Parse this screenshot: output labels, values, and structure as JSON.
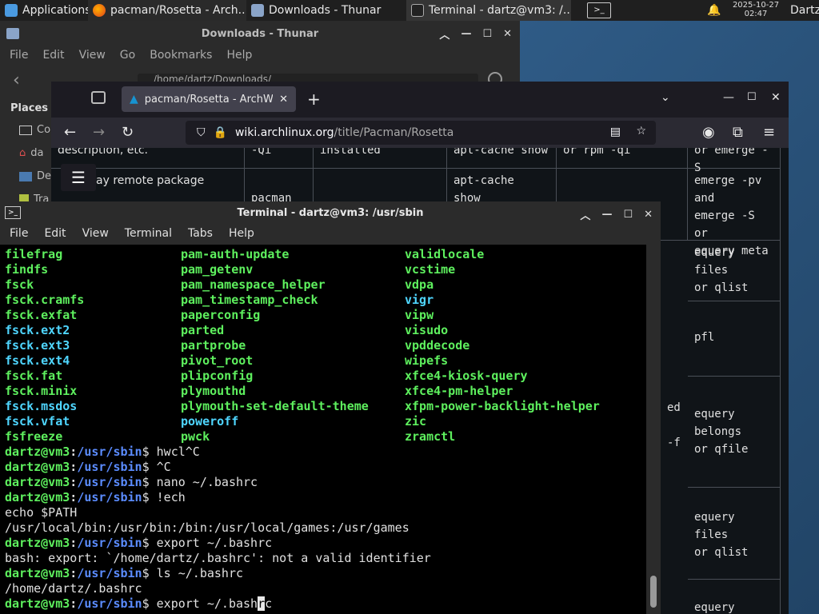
{
  "taskbar": {
    "applications": "Applications",
    "tasks": [
      {
        "label": "pacman/Rosetta - Arch..."
      },
      {
        "label": "Downloads - Thunar"
      },
      {
        "label": "Terminal - dartz@vm3: /..."
      }
    ],
    "clock_date": "2025-10-27",
    "clock_time": "02:47",
    "user": "Dartz"
  },
  "thunar": {
    "title": "Downloads - Thunar",
    "menu": [
      "File",
      "Edit",
      "View",
      "Go",
      "Bookmarks",
      "Help"
    ],
    "path": "/home/dartz/Downloads/",
    "places_heading": "Places",
    "places": [
      "Co",
      "da",
      "De",
      "Tra"
    ]
  },
  "firefox": {
    "tab_title": "pacman/Rosetta - ArchW",
    "url_host": "wiki.archlinux.org",
    "url_path": "/title/Pacman/Rosetta",
    "table": {
      "r1c0": "description, etc.",
      "r1c1": "-Qi",
      "r1c2": "installed",
      "r1c3": "apt-cache show",
      "r1c4": "or rpm -qi",
      "r1c5": "or emerge -S",
      "r2c0": "ay remote package",
      "r2c1": "pacman",
      "r2c3": "apt-cache\nshow",
      "r2c5": "emerge -pv\nand\nemerge -S or\nequery meta",
      "r3c5": "equery\nfiles\nor qlist",
      "r4c5": "pfl",
      "r5c4a": "ed",
      "r5c4b": "-f",
      "r5c5": "equery\nbelongs\nor qfile",
      "r6c5": "equery\nfiles\nor qlist",
      "r7c5": "equery"
    }
  },
  "terminal": {
    "title": "Terminal - dartz@vm3: /usr/sbin",
    "menu": [
      "File",
      "Edit",
      "View",
      "Terminal",
      "Tabs",
      "Help"
    ],
    "columns": [
      [
        {
          "t": "filefrag",
          "k": "exe"
        },
        {
          "t": "findfs",
          "k": "exe"
        },
        {
          "t": "fsck",
          "k": "exe"
        },
        {
          "t": "fsck.cramfs",
          "k": "exe"
        },
        {
          "t": "fsck.exfat",
          "k": "exe"
        },
        {
          "t": "fsck.ext2",
          "k": "lnk"
        },
        {
          "t": "fsck.ext3",
          "k": "lnk"
        },
        {
          "t": "fsck.ext4",
          "k": "lnk"
        },
        {
          "t": "fsck.fat",
          "k": "exe"
        },
        {
          "t": "fsck.minix",
          "k": "exe"
        },
        {
          "t": "fsck.msdos",
          "k": "lnk"
        },
        {
          "t": "fsck.vfat",
          "k": "lnk"
        },
        {
          "t": "fsfreeze",
          "k": "exe"
        }
      ],
      [
        {
          "t": "pam-auth-update",
          "k": "exe"
        },
        {
          "t": "pam_getenv",
          "k": "exe"
        },
        {
          "t": "pam_namespace_helper",
          "k": "exe"
        },
        {
          "t": "pam_timestamp_check",
          "k": "exe"
        },
        {
          "t": "paperconfig",
          "k": "exe"
        },
        {
          "t": "parted",
          "k": "exe"
        },
        {
          "t": "partprobe",
          "k": "exe"
        },
        {
          "t": "pivot_root",
          "k": "exe"
        },
        {
          "t": "plipconfig",
          "k": "exe"
        },
        {
          "t": "plymouthd",
          "k": "exe"
        },
        {
          "t": "plymouth-set-default-theme",
          "k": "exe"
        },
        {
          "t": "poweroff",
          "k": "lnk"
        },
        {
          "t": "pwck",
          "k": "exe"
        }
      ],
      [
        {
          "t": "validlocale",
          "k": "exe"
        },
        {
          "t": "vcstime",
          "k": "exe"
        },
        {
          "t": "vdpa",
          "k": "exe"
        },
        {
          "t": "vigr",
          "k": "lnk"
        },
        {
          "t": "vipw",
          "k": "exe"
        },
        {
          "t": "visudo",
          "k": "exe"
        },
        {
          "t": "vpddecode",
          "k": "exe"
        },
        {
          "t": "wipefs",
          "k": "exe"
        },
        {
          "t": "xfce4-kiosk-query",
          "k": "exe"
        },
        {
          "t": "xfce4-pm-helper",
          "k": "exe"
        },
        {
          "t": "xfpm-power-backlight-helper",
          "k": "exe"
        },
        {
          "t": "zic",
          "k": "exe"
        },
        {
          "t": "zramctl",
          "k": "exe"
        }
      ]
    ],
    "prompt_user": "dartz@vm3",
    "prompt_path": "/usr/sbin",
    "lines": [
      {
        "prompt": true,
        "cmd": " hwcl^C"
      },
      {
        "prompt": true,
        "cmd": " ^C"
      },
      {
        "prompt": true,
        "cmd": " nano ~/.bashrc"
      },
      {
        "prompt": true,
        "cmd": " !ech"
      },
      {
        "prompt": false,
        "text": "echo $PATH"
      },
      {
        "prompt": false,
        "text": "/usr/local/bin:/usr/bin:/bin:/usr/local/games:/usr/games"
      },
      {
        "prompt": true,
        "cmd": " export ~/.bashrc"
      },
      {
        "prompt": false,
        "text": "bash: export: `/home/dartz/.bashrc': not a valid identifier"
      },
      {
        "prompt": true,
        "cmd": " ls ~/.bashrc"
      },
      {
        "prompt": false,
        "text": "/home/dartz/.bashrc"
      },
      {
        "prompt": true,
        "cmd": " export ~/.bash",
        "cursor": "r",
        "after": "c"
      }
    ]
  }
}
